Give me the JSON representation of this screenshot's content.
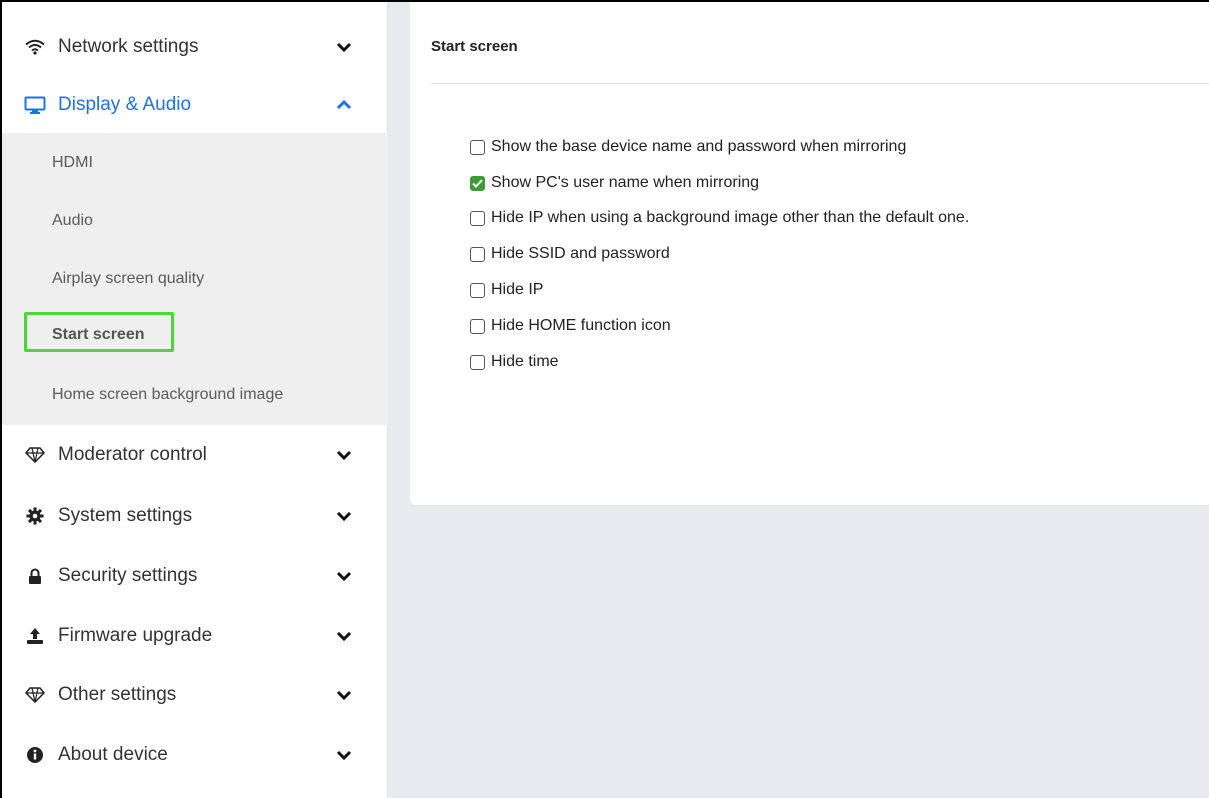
{
  "sidebar": {
    "items": [
      {
        "label": "Network settings",
        "icon": "wifi-icon",
        "expanded": false
      },
      {
        "label": "Display & Audio",
        "icon": "monitor-icon",
        "expanded": true
      },
      {
        "label": "Moderator control",
        "icon": "diamond-icon",
        "expanded": false
      },
      {
        "label": "System settings",
        "icon": "gear-icon",
        "expanded": false
      },
      {
        "label": "Security settings",
        "icon": "lock-icon",
        "expanded": false
      },
      {
        "label": "Firmware upgrade",
        "icon": "upload-icon",
        "expanded": false
      },
      {
        "label": "Other settings",
        "icon": "diamond-icon",
        "expanded": false
      },
      {
        "label": "About device",
        "icon": "info-icon",
        "expanded": false
      }
    ],
    "subitems": [
      {
        "label": "HDMI"
      },
      {
        "label": "Audio"
      },
      {
        "label": "Airplay screen quality"
      },
      {
        "label": "Start screen",
        "selected": true
      },
      {
        "label": "Home screen background image"
      }
    ],
    "active_color": "#1a73e8",
    "selected_border_color": "#4fd33a"
  },
  "main": {
    "title": "Start screen",
    "options": [
      {
        "label": "Show the base device name and password when mirroring",
        "checked": false
      },
      {
        "label": "Show PC's user name when mirroring",
        "checked": true
      },
      {
        "label": "Hide IP when using a background image other than the default one.",
        "checked": false
      },
      {
        "label": "Hide SSID and password",
        "checked": false
      },
      {
        "label": "Hide IP",
        "checked": false
      },
      {
        "label": "Hide HOME function icon",
        "checked": false
      },
      {
        "label": "Hide time",
        "checked": false
      }
    ],
    "check_color": "#3d9b35"
  }
}
